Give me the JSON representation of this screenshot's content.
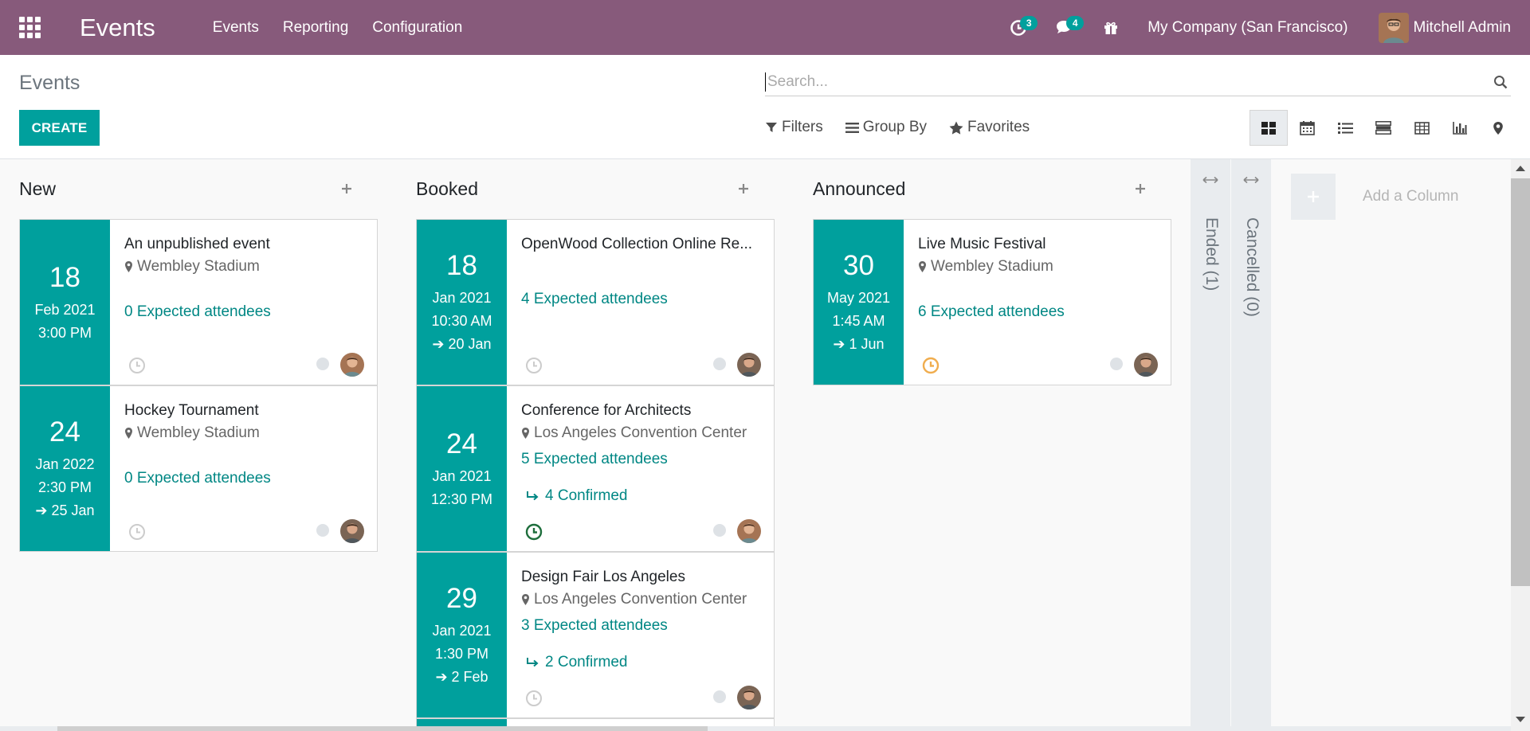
{
  "navbar": {
    "app_title": "Events",
    "menu": [
      "Events",
      "Reporting",
      "Configuration"
    ],
    "activity_count": "3",
    "message_count": "4",
    "company": "My Company (San Francisco)",
    "user_name": "Mitchell Admin"
  },
  "control": {
    "breadcrumb": "Events",
    "create_label": "CREATE",
    "search_placeholder": "Search...",
    "filters_label": "Filters",
    "groupby_label": "Group By",
    "favorites_label": "Favorites",
    "views": [
      "kanban",
      "calendar",
      "list",
      "activity",
      "pivot",
      "graph",
      "map"
    ],
    "active_view": "kanban"
  },
  "columns": [
    {
      "title": "New",
      "cards": [
        {
          "day": "18",
          "month_year": "Feb 2021",
          "time": "3:00 PM",
          "end": "",
          "title": "An unpublished event",
          "location": "Wembley Stadium",
          "attendees": "0 Expected attendees",
          "confirmed": "",
          "activity": "none"
        },
        {
          "day": "24",
          "month_year": "Jan 2022",
          "time": "2:30 PM",
          "end": "25 Jan",
          "title": "Hockey Tournament",
          "location": "Wembley Stadium",
          "attendees": "0 Expected attendees",
          "confirmed": "",
          "activity": "none"
        }
      ]
    },
    {
      "title": "Booked",
      "cards": [
        {
          "day": "18",
          "month_year": "Jan 2021",
          "time": "10:30 AM",
          "end": "20 Jan",
          "title": "OpenWood Collection Online Re...",
          "location": "",
          "attendees": "4 Expected attendees",
          "confirmed": "",
          "activity": "none"
        },
        {
          "day": "24",
          "month_year": "Jan 2021",
          "time": "12:30 PM",
          "end": "",
          "title": "Conference for Architects",
          "location": "Los Angeles Convention Center",
          "attendees": "5 Expected attendees",
          "confirmed": "4 Confirmed",
          "activity": "planned"
        },
        {
          "day": "29",
          "month_year": "Jan 2021",
          "time": "1:30 PM",
          "end": "2 Feb",
          "title": "Design Fair Los Angeles",
          "location": "Los Angeles Convention Center",
          "attendees": "3 Expected attendees",
          "confirmed": "2 Confirmed",
          "activity": "none"
        }
      ]
    },
    {
      "title": "Announced",
      "cards": [
        {
          "day": "30",
          "month_year": "May 2021",
          "time": "1:45 AM",
          "end": "1 Jun",
          "title": "Live Music Festival",
          "location": "Wembley Stadium",
          "attendees": "6 Expected attendees",
          "confirmed": "",
          "activity": "today"
        }
      ]
    }
  ],
  "folded_columns": [
    "Ended (1)",
    "Cancelled (0)"
  ],
  "add_column_label": "Add a Column",
  "colors": {
    "brand": "#875a7b",
    "accent": "#00a09d",
    "link": "#008784",
    "activity_today": "#f0ad4e",
    "activity_planned": "#1e6e3c"
  }
}
